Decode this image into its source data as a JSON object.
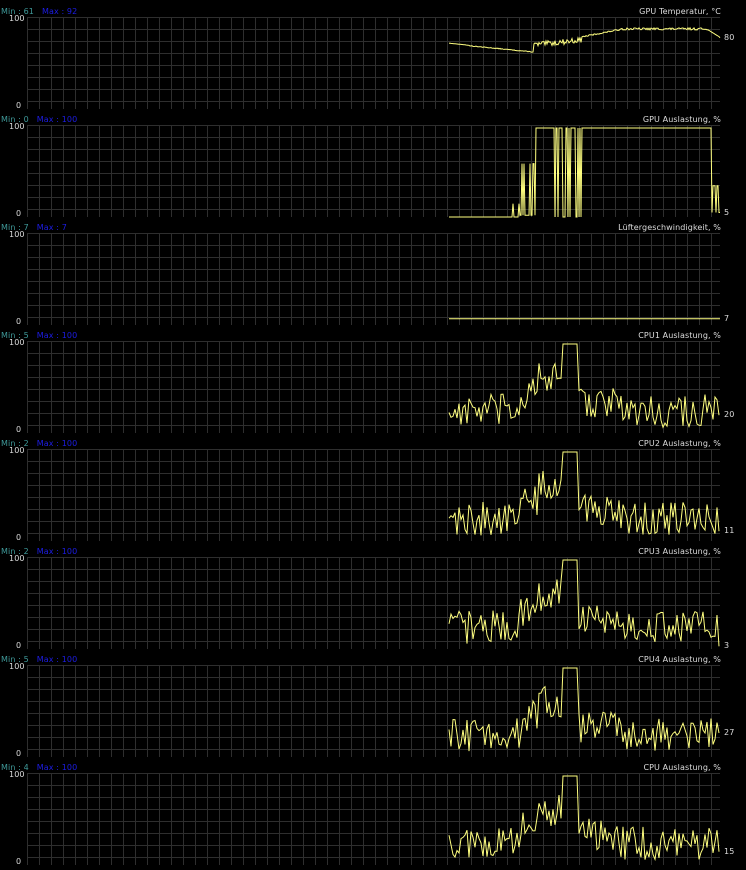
{
  "colors": {
    "background": "#000000",
    "grid": "#2e2e2e",
    "trace": "#ffff80",
    "min_label": "#3f9a9a",
    "max_label": "#1d1de6",
    "text": "#dcdcdc"
  },
  "panels": [
    {
      "title": "GPU Temperatur, °C",
      "min_label": "Min : 61",
      "max_label": "Max : 92",
      "y_top": "100",
      "y_bottom": "0",
      "current_value": 80,
      "current_label": "80"
    },
    {
      "title": "GPU Auslastung, %",
      "min_label": "Min : 0",
      "max_label": "Max : 100",
      "y_top": "100",
      "y_bottom": "0",
      "current_value": 5,
      "current_label": "5"
    },
    {
      "title": "Lüftergeschwindigkeit, %",
      "min_label": "Min : 7",
      "max_label": "Max : 7",
      "y_top": "100",
      "y_bottom": "0",
      "current_value": 7,
      "current_label": "7"
    },
    {
      "title": "CPU1 Auslastung, %",
      "min_label": "Min : 5",
      "max_label": "Max : 100",
      "y_top": "100",
      "y_bottom": "0",
      "current_value": 20,
      "current_label": "20"
    },
    {
      "title": "CPU2 Auslastung, %",
      "min_label": "Min : 2",
      "max_label": "Max : 100",
      "y_top": "100",
      "y_bottom": "0",
      "current_value": 11,
      "current_label": "11"
    },
    {
      "title": "CPU3 Auslastung, %",
      "min_label": "Min : 2",
      "max_label": "Max : 100",
      "y_top": "100",
      "y_bottom": "0",
      "current_value": 3,
      "current_label": "3"
    },
    {
      "title": "CPU4 Auslastung, %",
      "min_label": "Min : 5",
      "max_label": "Max : 100",
      "y_top": "100",
      "y_bottom": "0",
      "current_value": 27,
      "current_label": "27"
    },
    {
      "title": "CPU Auslastung, %",
      "min_label": "Min : 4",
      "max_label": "Max : 100",
      "y_top": "100",
      "y_bottom": "0",
      "current_value": 15,
      "current_label": "15"
    }
  ]
}
